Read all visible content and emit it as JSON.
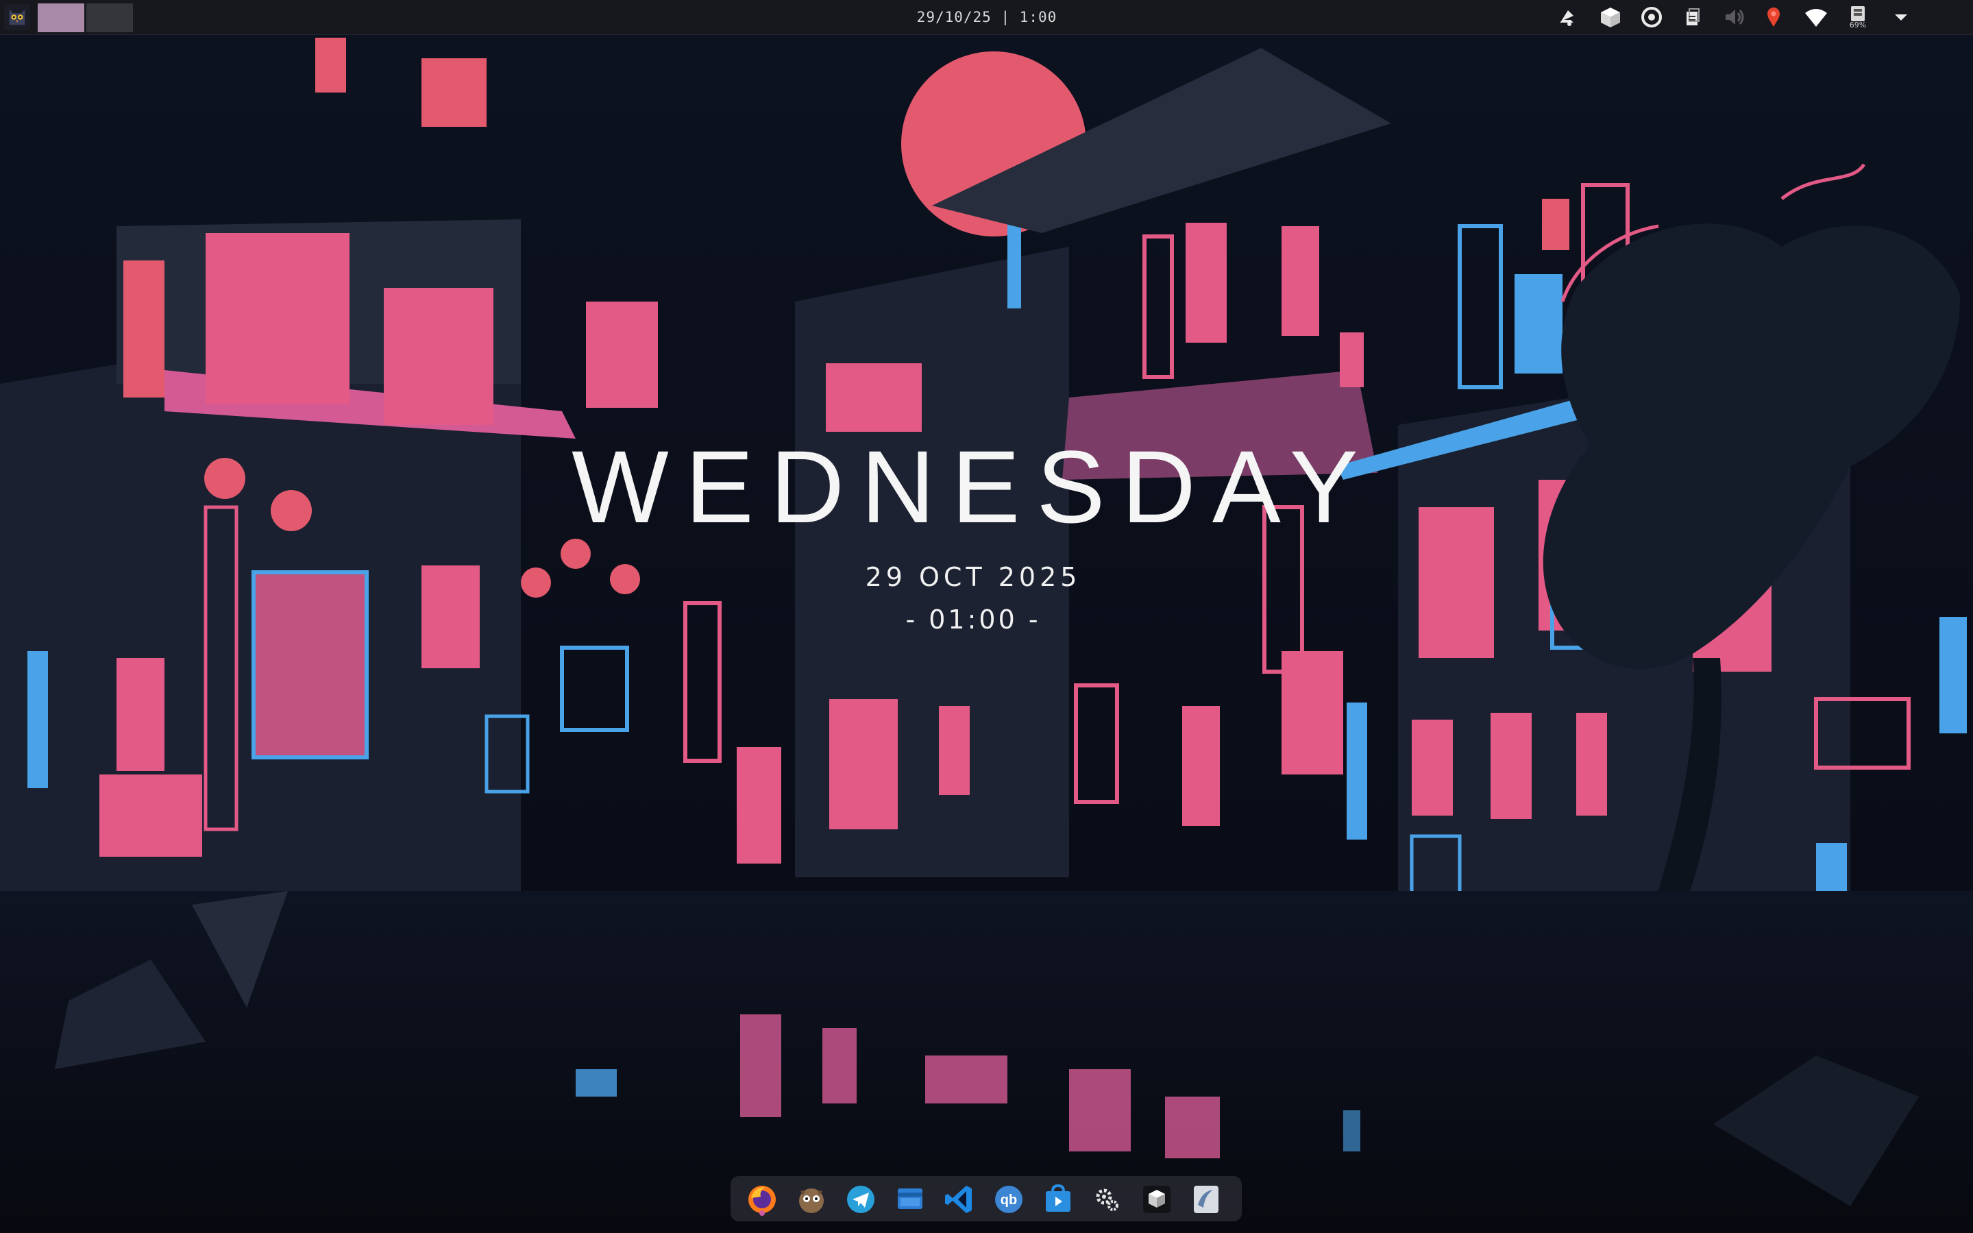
{
  "topbar": {
    "workspaces": [
      "workspace-1",
      "workspace-2"
    ],
    "active_workspace": "workspace-1",
    "datetime": "29/10/25 | 1:00",
    "tray_icons": [
      "notifications-icon",
      "package-icon",
      "sync-icon",
      "clipboard-icon",
      "volume-muted-icon",
      "location-pin-icon",
      "wifi-icon",
      "battery-icon",
      "menu-arrow-icon"
    ],
    "battery_percent": "69%"
  },
  "clock_widget": {
    "day": "WEDNESDAY",
    "date": "29 OCT 2025",
    "time": "- 01:00 -"
  },
  "dock": {
    "apps": [
      "firefox-icon",
      "terminal-icon",
      "telegram-icon",
      "files-icon",
      "vscode-icon",
      "qbittorrent-icon",
      "store-icon",
      "settings-icon",
      "app-box-icon",
      "app-wave-icon"
    ]
  },
  "colors": {
    "accent_pink": "#e35a86",
    "accent_blue": "#4aa3e8",
    "background": "#0b0e17",
    "bar": "#17181d",
    "workspace_active": "#a889a8"
  }
}
